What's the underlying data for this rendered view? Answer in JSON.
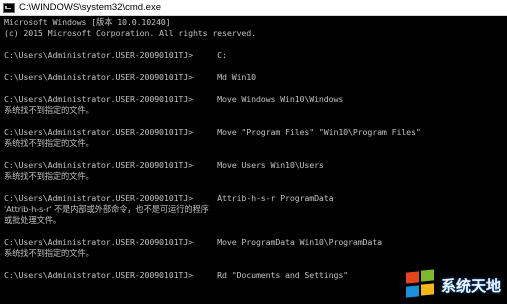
{
  "window": {
    "title": "C:\\WINDOWS\\system32\\cmd.exe",
    "icon": "cmd-icon"
  },
  "console": {
    "lines": [
      "Microsoft Windows [版本 10.0.10240]",
      "(c) 2015 Microsoft Corporation. All rights reserved.",
      "C:\\Users\\Administrator.USER-20090101TJ>     C:",
      "C:\\Users\\Administrator.USER-20090101TJ>     Md Win10",
      "C:\\Users\\Administrator.USER-20090101TJ>     Move Windows Win10\\Windows",
      "系统找不到指定的文件。",
      "C:\\Users\\Administrator.USER-20090101TJ>     Move \"Program Files\" \"Win10\\Program Files\"",
      "系统找不到指定的文件。",
      "C:\\Users\\Administrator.USER-20090101TJ>     Move Users Win10\\Users",
      "系统找不到指定的文件。",
      "C:\\Users\\Administrator.USER-20090101TJ>     Attrib-h-s-r ProgramData",
      "'Attrib-h-s-r' 不是内部或外部命令，也不是可运行的程序",
      "或批处理文件。",
      "C:\\Users\\Administrator.USER-20090101TJ>     Move ProgramData Win10\\ProgramData",
      "系统找不到指定的文件。",
      "C:\\Users\\Administrator.USER-20090101TJ>     Rd \"Documents and Settings\""
    ]
  },
  "watermark": {
    "text": "系统天地",
    "icon": "windows-logo-icon",
    "colors": [
      "#e3461f",
      "#7cb82f",
      "#1a8fdc",
      "#f2b619"
    ]
  }
}
